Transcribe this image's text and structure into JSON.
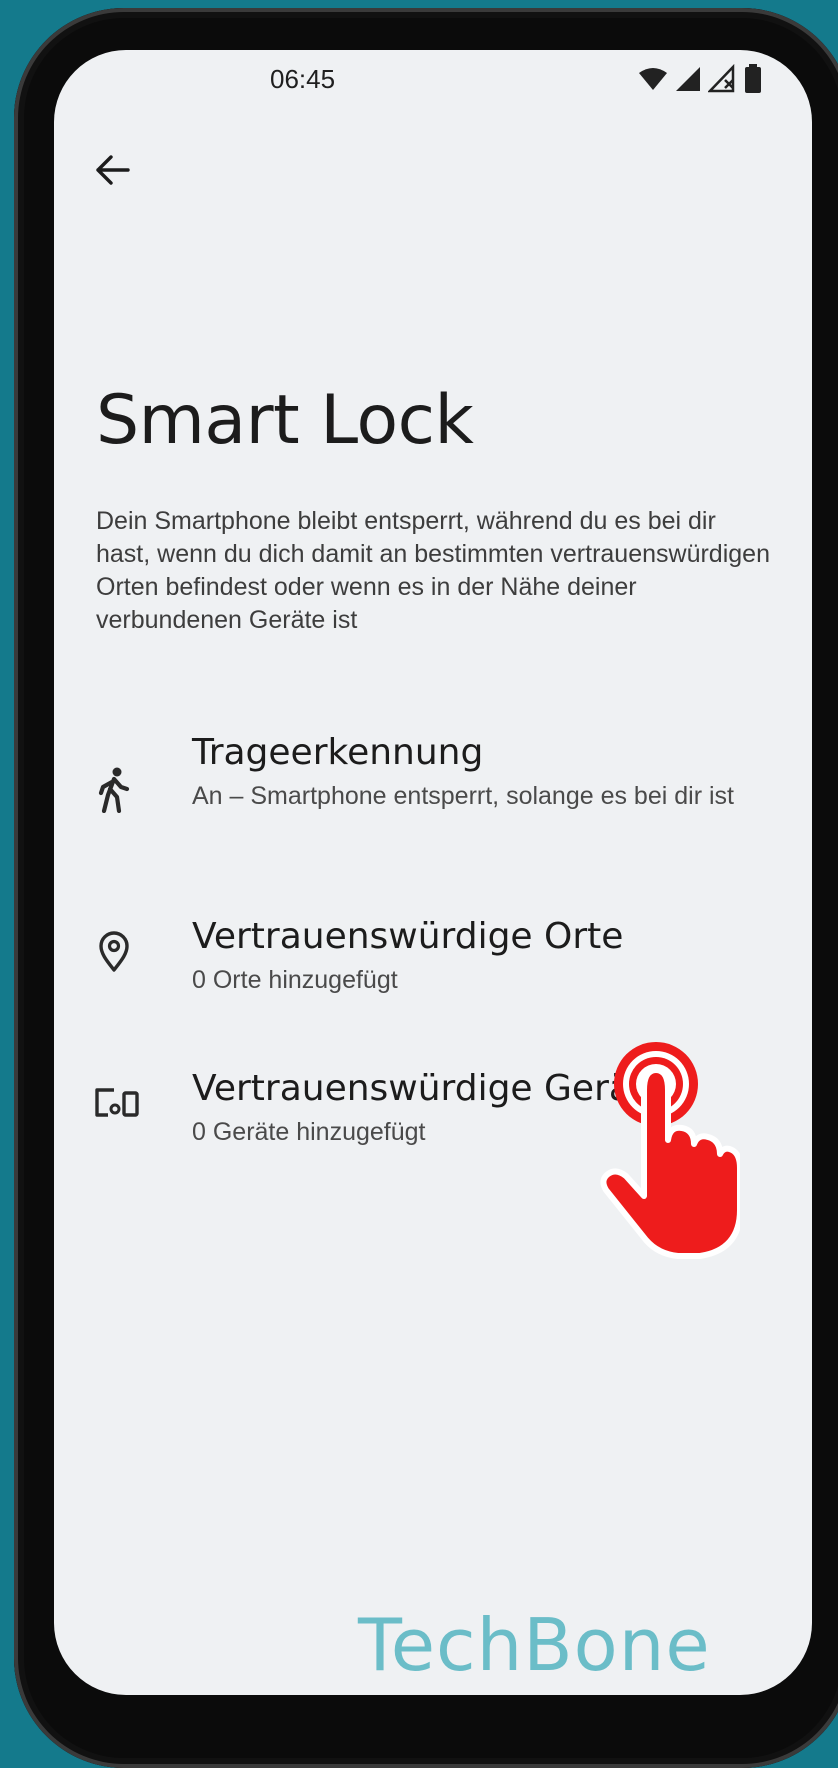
{
  "status_bar": {
    "time": "06:45",
    "icons": [
      "wifi-icon",
      "signal-icon",
      "signal-no-service-icon",
      "battery-icon"
    ]
  },
  "nav": {
    "back_icon": "arrow-back-icon"
  },
  "page": {
    "title": "Smart Lock",
    "description": "Dein Smartphone bleibt entsperrt, während du es bei dir hast, wenn du dich damit an bestimmten vertrauenswürdigen Orten befindest oder wenn es in der Nähe deiner verbundenen Geräte ist"
  },
  "items": [
    {
      "icon": "walking-person-icon",
      "title": "Trageerkennung",
      "subtitle": "An – Smartphone entsperrt, solange es bei dir ist"
    },
    {
      "icon": "location-pin-icon",
      "title": "Vertrauenswürdige Orte",
      "subtitle": "0 Orte hinzugefügt"
    },
    {
      "icon": "devices-icon",
      "title": "Vertrauenswürdige Geräte",
      "subtitle": "0 Geräte hinzugefügt"
    }
  ],
  "overlay": {
    "tap_indicator_icon": "tap-hand-icon",
    "tap_color": "#ee1c1c",
    "watermark": "TechBone"
  },
  "colors": {
    "background": "#147a8c",
    "screen": "#eff1f3",
    "watermark": "#6bbdc8"
  }
}
